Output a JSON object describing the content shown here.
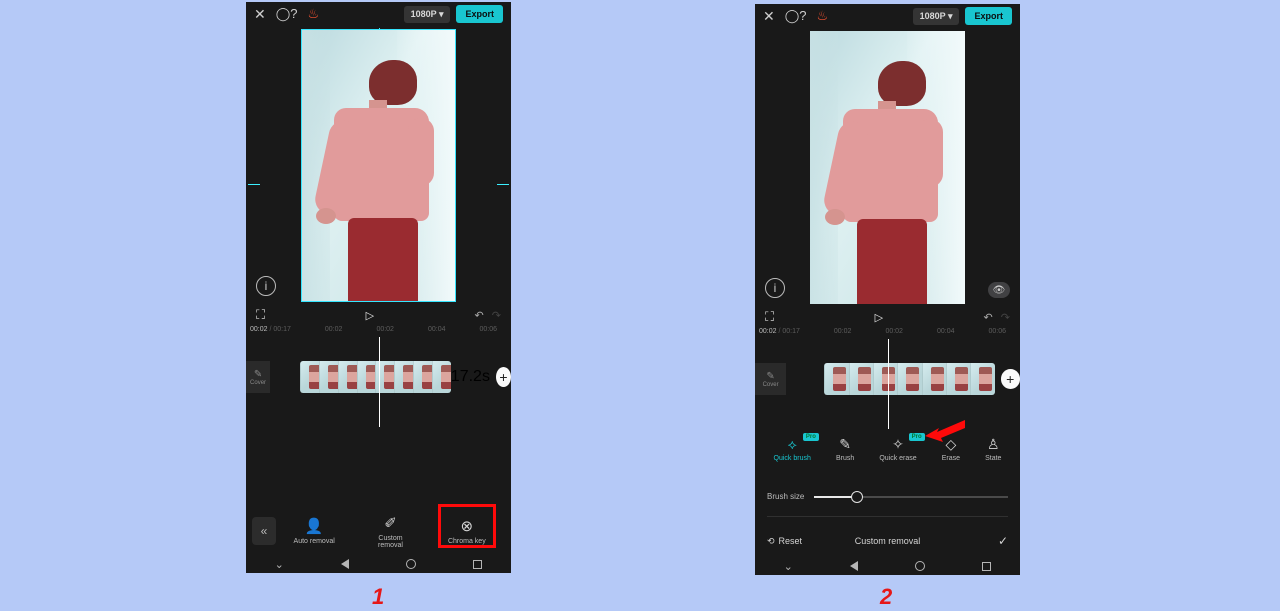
{
  "panel1": {
    "topbar": {
      "resolution": "1080P ▾",
      "export": "Export"
    },
    "playbar": {
      "time_current": "00:02",
      "time_sep": " / ",
      "time_total": "00:17"
    },
    "ruler": {
      "t0": "00:02",
      "t1": "00:02",
      "t2": "00:02",
      "t3": "00:04",
      "t4": "00:06"
    },
    "clip": {
      "dur": "17.2s",
      "cover_label": "Cover"
    },
    "tools": {
      "auto_removal": "Auto removal",
      "custom_removal_line1": "Custom",
      "custom_removal_line2": "removal",
      "chroma_key": "Chroma key"
    }
  },
  "panel2": {
    "topbar": {
      "resolution": "1080P ▾",
      "export": "Export"
    },
    "playbar": {
      "time_current": "00:02",
      "time_sep": " / ",
      "time_total": "00:17"
    },
    "ruler": {
      "t0": "00:02",
      "t1": "00:02",
      "t2": "00:02",
      "t3": "00:04",
      "t4": "00:06"
    },
    "clip": {
      "cover_label": "Cover"
    },
    "tools": {
      "quick_brush": "Quick brush",
      "brush": "Brush",
      "quick_erase": "Quick erase",
      "erase": "Erase",
      "state": "State"
    },
    "brush_size_label": "Brush size",
    "confirm": {
      "reset": "Reset",
      "title": "Custom removal"
    }
  },
  "steps": {
    "one": "1",
    "two": "2"
  }
}
